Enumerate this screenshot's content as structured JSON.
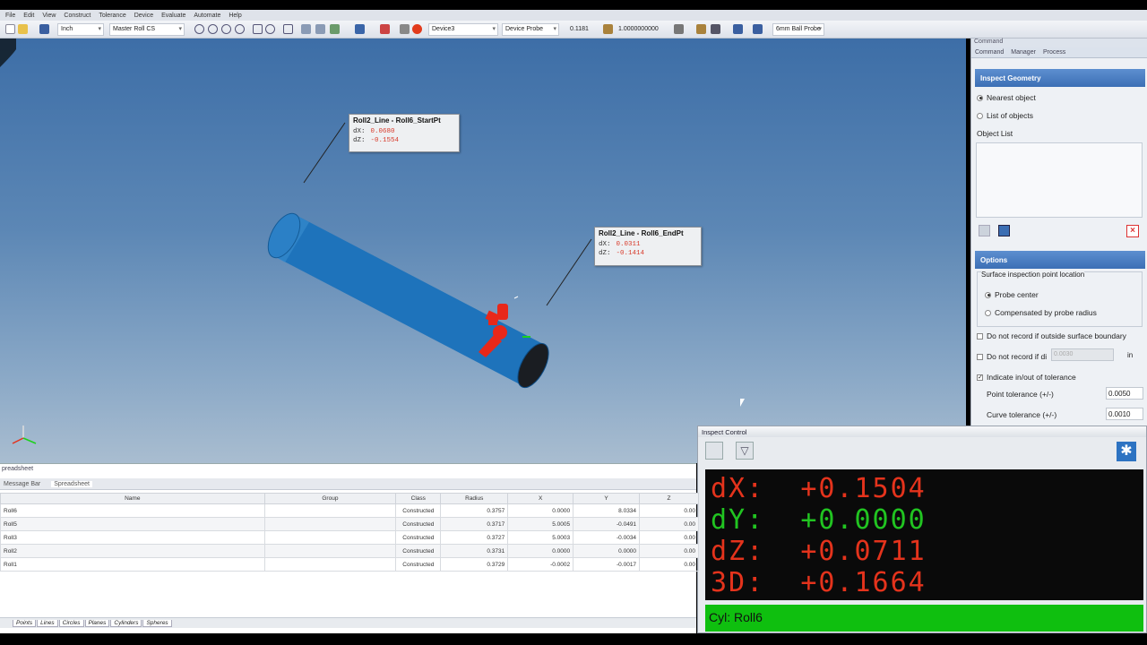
{
  "menu": [
    "File",
    "Edit",
    "View",
    "Construct",
    "Tolerance",
    "Device",
    "Evaluate",
    "Automate",
    "Help"
  ],
  "toolbar": {
    "units": "Inch",
    "cs": "Master Roll CS",
    "device": "Device3",
    "probe": "Device Probe",
    "val1": "0.1181",
    "val2": "1.0000000000",
    "probe_name": "6mm Ball Probe"
  },
  "callouts": [
    {
      "title": "Roll2_Line - Roll6_StartPt",
      "dx_label": "dX:",
      "dx": "0.0680",
      "dz_label": "dZ:",
      "dz": "-0.1554"
    },
    {
      "title": "Roll2_Line - Roll6_EndPt",
      "dx_label": "dX:",
      "dx": "0.0311",
      "dz_label": "dZ:",
      "dz": "-0.1414"
    }
  ],
  "panel": {
    "title": "Command",
    "tabs": [
      "Command",
      "Manager",
      "Process"
    ],
    "section": "Inspect Geometry",
    "nearest": "Nearest object",
    "list": "List of objects",
    "object_list": "Object List",
    "options": "Options",
    "surface_group": "Surface inspection point location",
    "probe_center": "Probe center",
    "compensated": "Compensated by probe radius",
    "not_record_outside": "Do not record if outside surface boundary",
    "not_record_di": "Do not record if di",
    "di_value": "0.0030",
    "di_unit": "in",
    "indicate": "Indicate in/out of tolerance",
    "point_tol": "Point tolerance (+/-)",
    "point_tol_val": "0.0050",
    "curve_tol": "Curve tolerance (+/-)",
    "curve_tol_val": "0.0010"
  },
  "inspect": {
    "title": "Inspect Control",
    "rows": [
      {
        "label": "dX:",
        "value": "+0.1504",
        "color": "#e4331c"
      },
      {
        "label": "dY:",
        "value": "+0.0000",
        "color": "#21c421"
      },
      {
        "label": "dZ:",
        "value": "+0.0711",
        "color": "#e4331c"
      },
      {
        "label": "3D:",
        "value": "+0.1664",
        "color": "#e4331c"
      }
    ],
    "status": "Cyl: Roll6"
  },
  "sheet": {
    "title": "preadsheet",
    "tabs": [
      "Message Bar",
      "Spreadsheet"
    ],
    "columns": [
      "Name",
      "Group",
      "Class",
      "Radius",
      "X",
      "Y",
      "Z"
    ],
    "rows": [
      [
        "Roll6",
        "",
        "Constructed",
        "0.3757",
        "0.0000",
        "8.0334",
        "0.00"
      ],
      [
        "Roll5",
        "",
        "Constructed",
        "0.3717",
        "5.0005",
        "-0.0491",
        "0.00"
      ],
      [
        "Roll3",
        "",
        "Constructed",
        "0.3727",
        "5.0003",
        "-0.0034",
        "0.00"
      ],
      [
        "Roll2",
        "",
        "Constructed",
        "0.3731",
        "0.0000",
        "0.0000",
        "0.00"
      ],
      [
        "Roll1",
        "",
        "Constructed",
        "0.3729",
        "-0.0002",
        "-0.0017",
        "0.00"
      ]
    ],
    "bottom_tabs": [
      "Points",
      "Lines",
      "Circles",
      "Planes",
      "Cylinders",
      "Spheres"
    ]
  }
}
